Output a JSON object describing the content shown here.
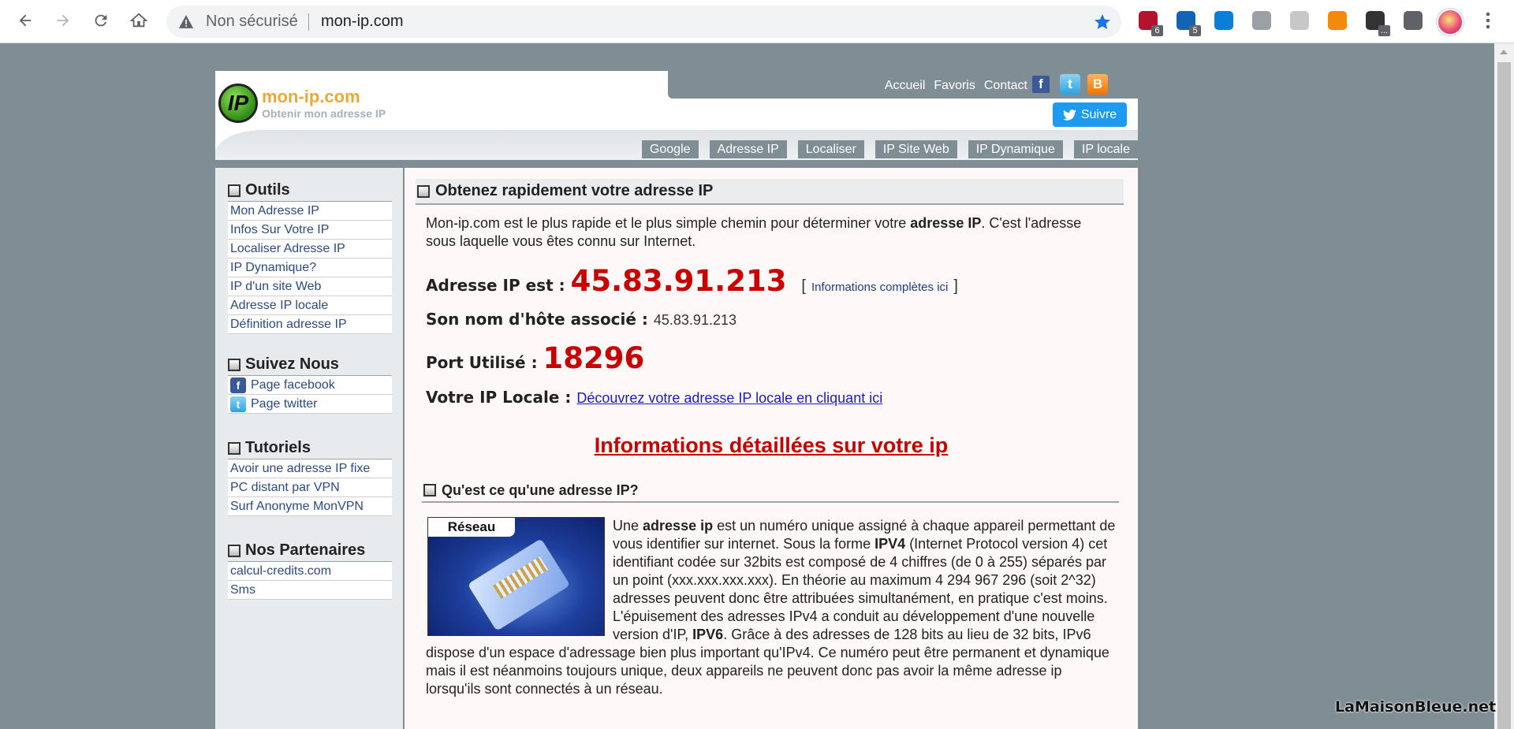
{
  "browser": {
    "security_label": "Non sécurisé",
    "url": "mon-ip.com",
    "extensions": [
      {
        "name": "ublock-icon",
        "badge": "6",
        "color": "#b5122e"
      },
      {
        "name": "malwarebytes-icon",
        "badge": "5",
        "color": "#1463b4"
      },
      {
        "name": "skype-icon",
        "badge": "",
        "color": "#0a7fd4"
      },
      {
        "name": "shield-icon",
        "badge": "",
        "color": "#9aa0a6"
      },
      {
        "name": "arch-icon",
        "badge": "",
        "color": "#c7c7c7"
      },
      {
        "name": "vlc-icon",
        "badge": "",
        "color": "#f48a0a"
      },
      {
        "name": "speedometer-icon",
        "badge": "...",
        "color": "#333333"
      },
      {
        "name": "puzzle-icon",
        "badge": "",
        "color": "#5f6368"
      }
    ]
  },
  "site": {
    "brand": "mon-ip.com",
    "tagline": "Obtenir mon adresse IP",
    "logo_text": "IP",
    "top_links": [
      "Accueil",
      "Favoris",
      "Contact"
    ],
    "follow_label": "Suivre",
    "tabs": [
      "Google",
      "Adresse IP",
      "Localiser",
      "IP Site Web",
      "IP Dynamique",
      "IP locale"
    ]
  },
  "sidebar": {
    "sections": [
      {
        "title": "Outils",
        "items": [
          "Mon Adresse IP",
          "Infos Sur Votre IP",
          "Localiser Adresse IP",
          "IP Dynamique?",
          "IP d'un site Web",
          "Adresse IP locale",
          "Définition adresse IP"
        ]
      },
      {
        "title": "Suivez Nous",
        "items": [
          "Page facebook",
          "Page twitter"
        ]
      },
      {
        "title": "Tutoriels",
        "items": [
          "Avoir une adresse IP fixe",
          "PC distant par VPN",
          "Surf Anonyme MonVPN"
        ]
      },
      {
        "title": "Nos Partenaires",
        "items": [
          "calcul-credits.com",
          "Sms"
        ]
      }
    ]
  },
  "main": {
    "title": "Obtenez rapidement votre adresse IP",
    "intro_a": "Mon-ip.com est le plus rapide et le plus simple chemin pour déterminer votre ",
    "intro_b": "adresse IP",
    "intro_c": ". C'est l'adresse sous laquelle vous êtes connu sur Internet.",
    "ip_label": "Adresse IP est : ",
    "ip_value": "45.83.91.213",
    "ip_info_link": "Informations complètes ici",
    "hostname_label": "Son nom d'hôte associé : ",
    "hostname_value": "45.83.91.213",
    "port_label": "Port Utilisé : ",
    "port_value": "18296",
    "local_label": "Votre IP Locale : ",
    "local_link": "Découvrez votre adresse IP locale en cliquant ici",
    "details_link": "Informations détaillées sur votre ip",
    "question_title": "Qu'est ce qu'une adresse IP?",
    "image_label": "Réseau",
    "p_1": "Une ",
    "p_b1": "adresse ip",
    "p_2": " est un numéro unique assigné à chaque appareil permettant de vous identifier sur internet. Sous la forme ",
    "p_b2": "IPV4",
    "p_3": " (Internet Protocol version 4) cet identifiant codée sur 32bits est composé de 4 chiffres (de 0 à 255) séparés par un point (xxx.xxx.xxx.xxx). En théorie au maximum 4 294 967 296 (soit 2^32) adresses peuvent donc être attribuées simultanément, en pratique c'est moins. L'épuisement des adresses IPv4 a conduit au développement d'une nouvelle version d'IP, ",
    "p_b3": "IPV6",
    "p_4": ". Grâce à des adresses de 128 bits au lieu de 32 bits, IPv6 dispose d'un espace d'adressage bien plus important qu'IPv4. Ce numéro peut être permanent et dynamique mais il est néanmoins toujours unique, deux appareils ne peuvent donc pas avoir la même adresse ip lorsqu'ils sont connectés à un réseau."
  },
  "watermark": "LaMaisonBleue.net",
  "colors": {
    "page_bg": "#7f8d95",
    "accent_red": "#c80000",
    "brand_orange": "#e8a93a",
    "link_blue": "#2a4b82"
  }
}
